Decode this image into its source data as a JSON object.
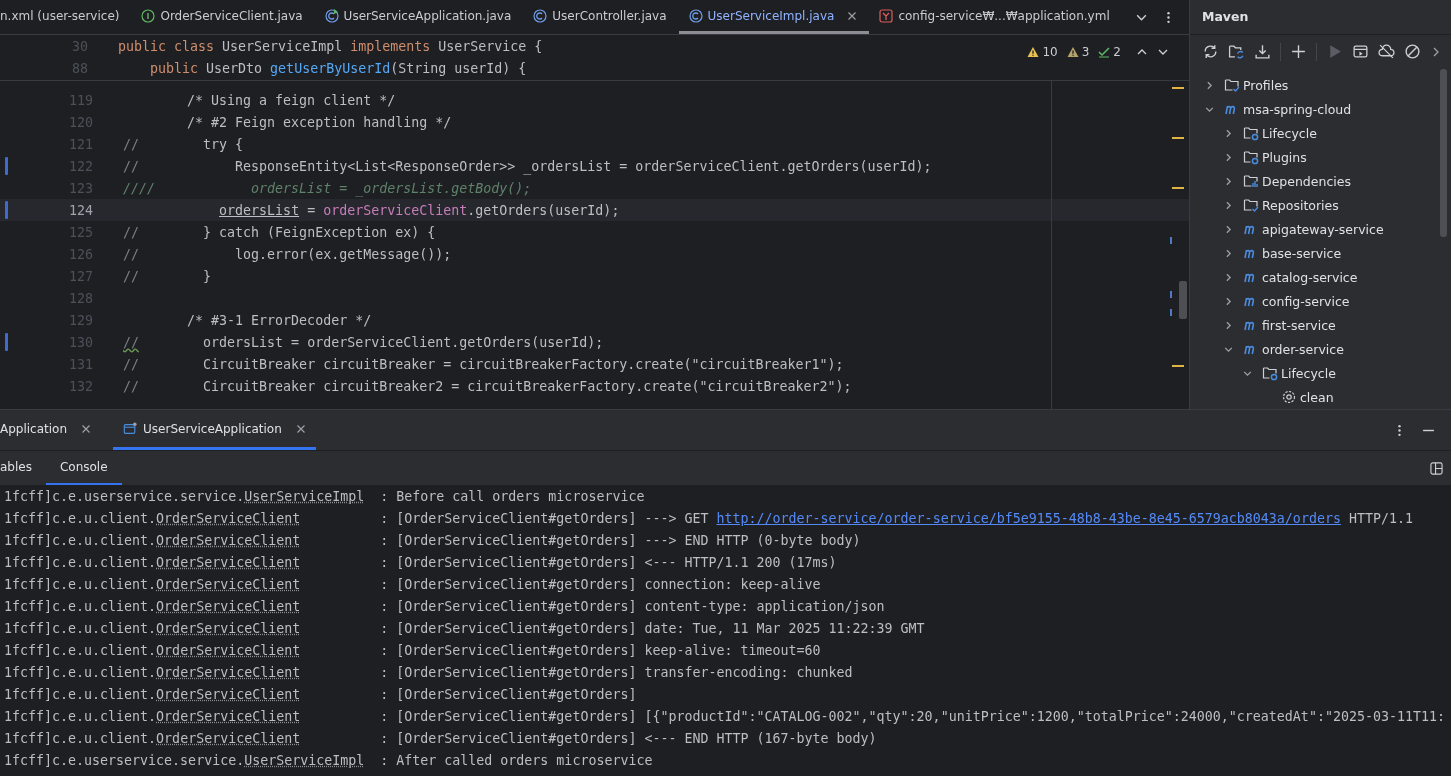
{
  "editor_tabs": [
    {
      "label": "n.xml (user-service)",
      "selected": false
    },
    {
      "label": "OrderServiceClient.java",
      "kind": "interface",
      "selected": false
    },
    {
      "label": "UserServiceApplication.java",
      "kind": "app",
      "selected": false
    },
    {
      "label": "UserController.java",
      "kind": "class",
      "selected": false
    },
    {
      "label": "UserServiceImpl.java",
      "kind": "class",
      "selected": true
    },
    {
      "label": "config-service₩...₩application.yml",
      "kind": "yaml",
      "selected": false
    }
  ],
  "inspections": [
    {
      "kind": "warning",
      "count": "10"
    },
    {
      "kind": "weak",
      "count": "3"
    },
    {
      "kind": "typo",
      "count": "2"
    }
  ],
  "sticky_lines": [
    {
      "number": "30",
      "parts": [
        {
          "kind": "keyword",
          "text": "public class "
        },
        {
          "kind": "plain",
          "text": "UserServiceImpl "
        },
        {
          "kind": "keyword",
          "text": "implements "
        },
        {
          "kind": "plain",
          "text": "UserService {"
        }
      ]
    },
    {
      "number": "88",
      "parts": [
        {
          "kind": "keyword",
          "text": "    public "
        },
        {
          "kind": "plain",
          "text": "UserDto "
        },
        {
          "kind": "method",
          "text": "getUserByUserId"
        },
        {
          "kind": "plain",
          "text": "(String userId) {"
        }
      ]
    }
  ],
  "code_lines": [
    {
      "number": "119",
      "changed": false,
      "current": false,
      "parts": [
        {
          "kind": "plain",
          "text": "        /* Using a feign client */"
        }
      ]
    },
    {
      "number": "120",
      "changed": false,
      "current": false,
      "parts": [
        {
          "kind": "plain",
          "text": "        /* #2 Feign exception handling */"
        }
      ]
    },
    {
      "number": "121",
      "changed": false,
      "current": false,
      "parts": [
        {
          "kind": "comment",
          "text": "//"
        },
        {
          "kind": "plain",
          "text": "        try {"
        }
      ]
    },
    {
      "number": "122",
      "changed": true,
      "current": false,
      "parts": [
        {
          "kind": "comment",
          "text": "//"
        },
        {
          "kind": "plain",
          "text": "            ResponseEntity<List<ResponseOrder>> _ordersList = orderServiceClient.getOrders(userId);"
        }
      ]
    },
    {
      "number": "123",
      "changed": false,
      "current": false,
      "parts": [
        {
          "kind": "doc",
          "text": "////            ordersList = _ordersList.getBody();"
        }
      ]
    },
    {
      "number": "124",
      "changed": true,
      "current": true,
      "parts": [
        {
          "kind": "var",
          "text": "            ordersList"
        },
        {
          "kind": "plain",
          "text": " = "
        },
        {
          "kind": "field",
          "text": "orderServiceClient"
        },
        {
          "kind": "plain",
          "text": ".getOrders(userId);"
        }
      ]
    },
    {
      "number": "125",
      "changed": false,
      "current": false,
      "parts": [
        {
          "kind": "comment",
          "text": "//"
        },
        {
          "kind": "plain",
          "text": "        } catch (FeignException ex) {"
        }
      ]
    },
    {
      "number": "126",
      "changed": false,
      "current": false,
      "parts": [
        {
          "kind": "comment",
          "text": "//"
        },
        {
          "kind": "plain",
          "text": "            log.error(ex.getMessage());"
        }
      ]
    },
    {
      "number": "127",
      "changed": false,
      "current": false,
      "parts": [
        {
          "kind": "comment",
          "text": "//"
        },
        {
          "kind": "plain",
          "text": "        }"
        }
      ]
    },
    {
      "number": "128",
      "changed": false,
      "current": false
    },
    {
      "number": "129",
      "changed": false,
      "current": false,
      "parts": [
        {
          "kind": "plain",
          "text": "        /* #3-1 ErrorDecoder */"
        }
      ]
    },
    {
      "number": "130",
      "changed": true,
      "current": false,
      "parts": [
        {
          "kind": "typo",
          "text": "//"
        },
        {
          "kind": "plain",
          "text": "        ordersList = orderServiceClient.getOrders(userId);"
        }
      ]
    },
    {
      "number": "131",
      "changed": false,
      "current": false,
      "parts": [
        {
          "kind": "comment",
          "text": "//"
        },
        {
          "kind": "plain",
          "text": "        CircuitBreaker circuitBreaker = circuitBreakerFactory.create(\"circuitBreaker1\");"
        }
      ]
    },
    {
      "number": "132",
      "changed": false,
      "current": false,
      "parts": [
        {
          "kind": "comment",
          "text": "//"
        },
        {
          "kind": "plain",
          "text": "        CircuitBreaker circuitBreaker2 = circuitBreakerFactory.create(\"circuitBreaker2\");"
        }
      ]
    }
  ],
  "maven": {
    "title": "Maven",
    "tree": [
      {
        "label": "Profiles",
        "kind": "profiles",
        "expanded": false
      },
      {
        "label": "msa-spring-cloud",
        "kind": "module",
        "expanded": true,
        "children": [
          {
            "label": "Lifecycle",
            "kind": "lifecycle",
            "expanded": false
          },
          {
            "label": "Plugins",
            "kind": "plugins",
            "expanded": false
          },
          {
            "label": "Dependencies",
            "kind": "dependencies",
            "expanded": false
          },
          {
            "label": "Repositories",
            "kind": "repositories",
            "expanded": false
          },
          {
            "label": "apigateway-service",
            "kind": "module",
            "expanded": false
          },
          {
            "label": "base-service",
            "kind": "module",
            "expanded": false
          },
          {
            "label": "catalog-service",
            "kind": "module",
            "expanded": false
          },
          {
            "label": "config-service",
            "kind": "module",
            "expanded": false
          },
          {
            "label": "first-service",
            "kind": "module",
            "expanded": false
          },
          {
            "label": "order-service",
            "kind": "module",
            "expanded": true,
            "children": [
              {
                "label": "Lifecycle",
                "kind": "lifecycle",
                "expanded": true,
                "children": [
                  {
                    "label": "clean",
                    "kind": "goal"
                  }
                ]
              }
            ]
          }
        ]
      }
    ]
  },
  "run_tabs": [
    {
      "label": "Application",
      "selected": false
    },
    {
      "label": "UserServiceApplication",
      "selected": true
    }
  ],
  "sub_tabs": [
    {
      "label": "ables",
      "selected": false
    },
    {
      "label": "Console",
      "selected": true
    }
  ],
  "console_lines": [
    {
      "prefix": "1fcff]c.e.userservice.service.",
      "logger": "UserServiceImpl",
      "message": [
        {
          "kind": "text",
          "text": ": Before call orders microservice"
        }
      ]
    },
    {
      "prefix": "1fcff]c.e.u.client.",
      "logger": "OrderServiceClient",
      "message": [
        {
          "kind": "text",
          "text": ": [OrderServiceClient#getOrders] ---> GET "
        },
        {
          "kind": "link",
          "text": "http://order-service/order-service/bf5e9155-48b8-43be-8e45-6579acb8043a/orders"
        },
        {
          "kind": "text",
          "text": " HTTP/1.1"
        }
      ]
    },
    {
      "prefix": "1fcff]c.e.u.client.",
      "logger": "OrderServiceClient",
      "message": [
        {
          "kind": "text",
          "text": ": [OrderServiceClient#getOrders] ---> END HTTP (0-byte body)"
        }
      ]
    },
    {
      "prefix": "1fcff]c.e.u.client.",
      "logger": "OrderServiceClient",
      "message": [
        {
          "kind": "text",
          "text": ": [OrderServiceClient#getOrders] <--- HTTP/1.1 200 (17ms)"
        }
      ]
    },
    {
      "prefix": "1fcff]c.e.u.client.",
      "logger": "OrderServiceClient",
      "message": [
        {
          "kind": "text",
          "text": ": [OrderServiceClient#getOrders] connection: keep-alive"
        }
      ]
    },
    {
      "prefix": "1fcff]c.e.u.client.",
      "logger": "OrderServiceClient",
      "message": [
        {
          "kind": "text",
          "text": ": [OrderServiceClient#getOrders] content-type: application/json"
        }
      ]
    },
    {
      "prefix": "1fcff]c.e.u.client.",
      "logger": "OrderServiceClient",
      "message": [
        {
          "kind": "text",
          "text": ": [OrderServiceClient#getOrders] date: Tue, 11 Mar 2025 11:22:39 GMT"
        }
      ]
    },
    {
      "prefix": "1fcff]c.e.u.client.",
      "logger": "OrderServiceClient",
      "message": [
        {
          "kind": "text",
          "text": ": [OrderServiceClient#getOrders] keep-alive: timeout=60"
        }
      ]
    },
    {
      "prefix": "1fcff]c.e.u.client.",
      "logger": "OrderServiceClient",
      "message": [
        {
          "kind": "text",
          "text": ": [OrderServiceClient#getOrders] transfer-encoding: chunked"
        }
      ]
    },
    {
      "prefix": "1fcff]c.e.u.client.",
      "logger": "OrderServiceClient",
      "message": [
        {
          "kind": "text",
          "text": ": [OrderServiceClient#getOrders]"
        }
      ]
    },
    {
      "prefix": "1fcff]c.e.u.client.",
      "logger": "OrderServiceClient",
      "message": [
        {
          "kind": "text",
          "text": ": [OrderServiceClient#getOrders] [{\"productId\":\"CATALOG-002\",\"qty\":20,\"unitPrice\":1200,\"totalPrice\":24000,\"createdAt\":\"2025-03-11T11:"
        }
      ]
    },
    {
      "prefix": "1fcff]c.e.u.client.",
      "logger": "OrderServiceClient",
      "message": [
        {
          "kind": "text",
          "text": ": [OrderServiceClient#getOrders] <--- END HTTP (167-byte body)"
        }
      ]
    },
    {
      "prefix": "1fcff]c.e.userservice.service.",
      "logger": "UserServiceImpl",
      "message": [
        {
          "kind": "text",
          "text": ": After called orders microservice"
        }
      ]
    }
  ]
}
